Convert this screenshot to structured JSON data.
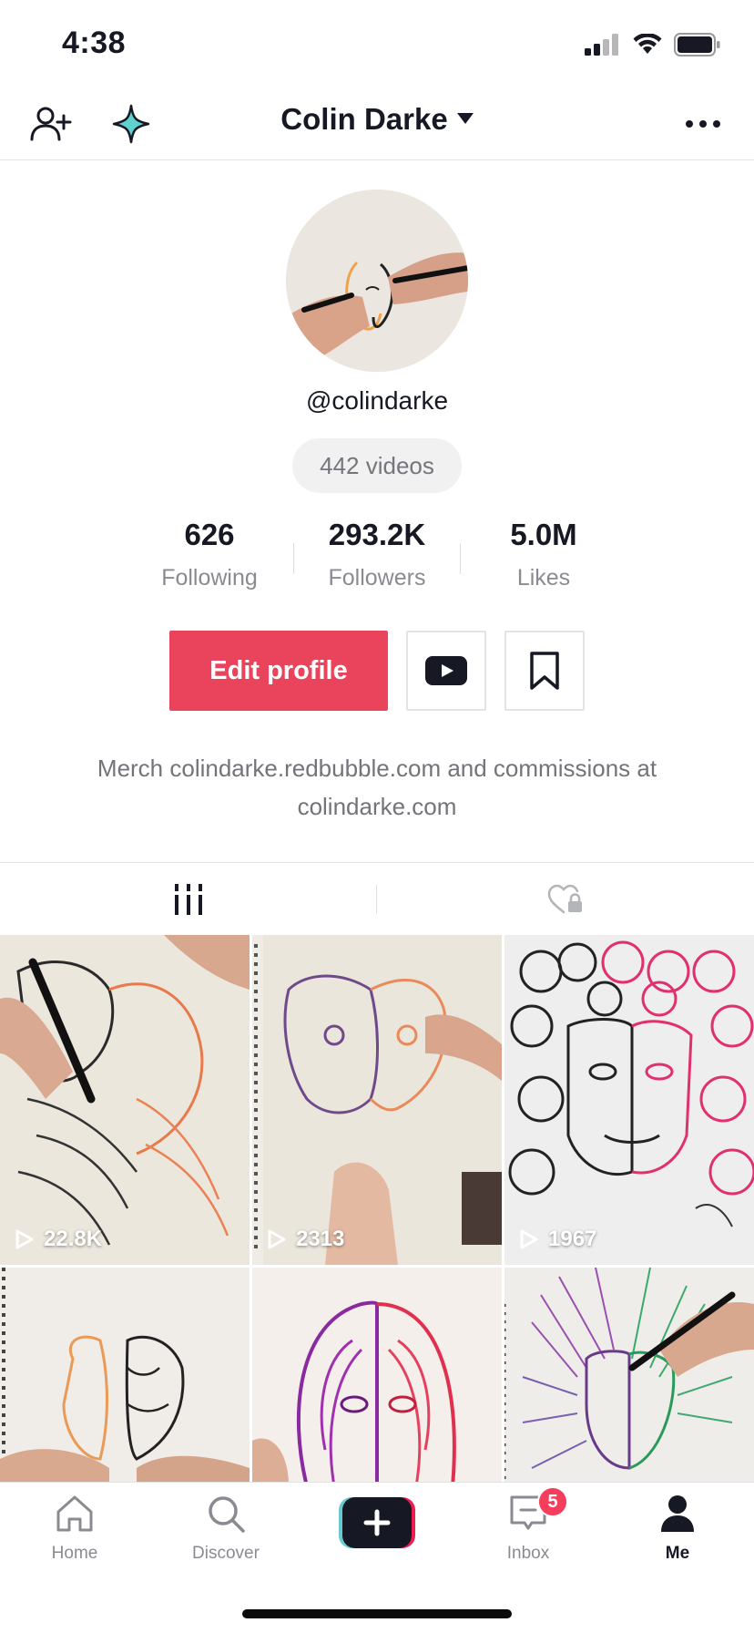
{
  "status_bar": {
    "time": "4:38"
  },
  "header": {
    "title": "Colin Darke",
    "add_friend_icon": "person-plus-icon",
    "sparkle_icon": "sparkle-icon",
    "more_icon": "ellipsis-icon"
  },
  "profile": {
    "username": "@colindarke",
    "videos_count": "442 videos",
    "stats": [
      {
        "value": "626",
        "label": "Following"
      },
      {
        "value": "293.2K",
        "label": "Followers"
      },
      {
        "value": "5.0M",
        "label": "Likes"
      }
    ],
    "edit_profile_label": "Edit profile",
    "bio": "Merch colindarke.redbubble.com and commissions at colindarke.com"
  },
  "tabs": [
    {
      "icon": "videos-grid-icon",
      "active": true
    },
    {
      "icon": "liked-private-icon",
      "active": false
    }
  ],
  "videos": [
    {
      "views": "22.8K"
    },
    {
      "views": "2313"
    },
    {
      "views": "1967"
    },
    {
      "views": ""
    },
    {
      "views": ""
    },
    {
      "views": ""
    }
  ],
  "bottom_nav": [
    {
      "label": "Home",
      "icon": "home-icon"
    },
    {
      "label": "Discover",
      "icon": "search-icon"
    },
    {
      "label": "",
      "icon": "create-plus-icon"
    },
    {
      "label": "Inbox",
      "icon": "inbox-icon",
      "badge": "5"
    },
    {
      "label": "Me",
      "icon": "profile-icon",
      "active": true
    }
  ],
  "colors": {
    "accent": "#ea435c",
    "text": "#161823",
    "muted": "#8a8b91",
    "badge": "#f43e5c",
    "create_cyan": "#69c9d0",
    "create_pink": "#ee1d52"
  }
}
